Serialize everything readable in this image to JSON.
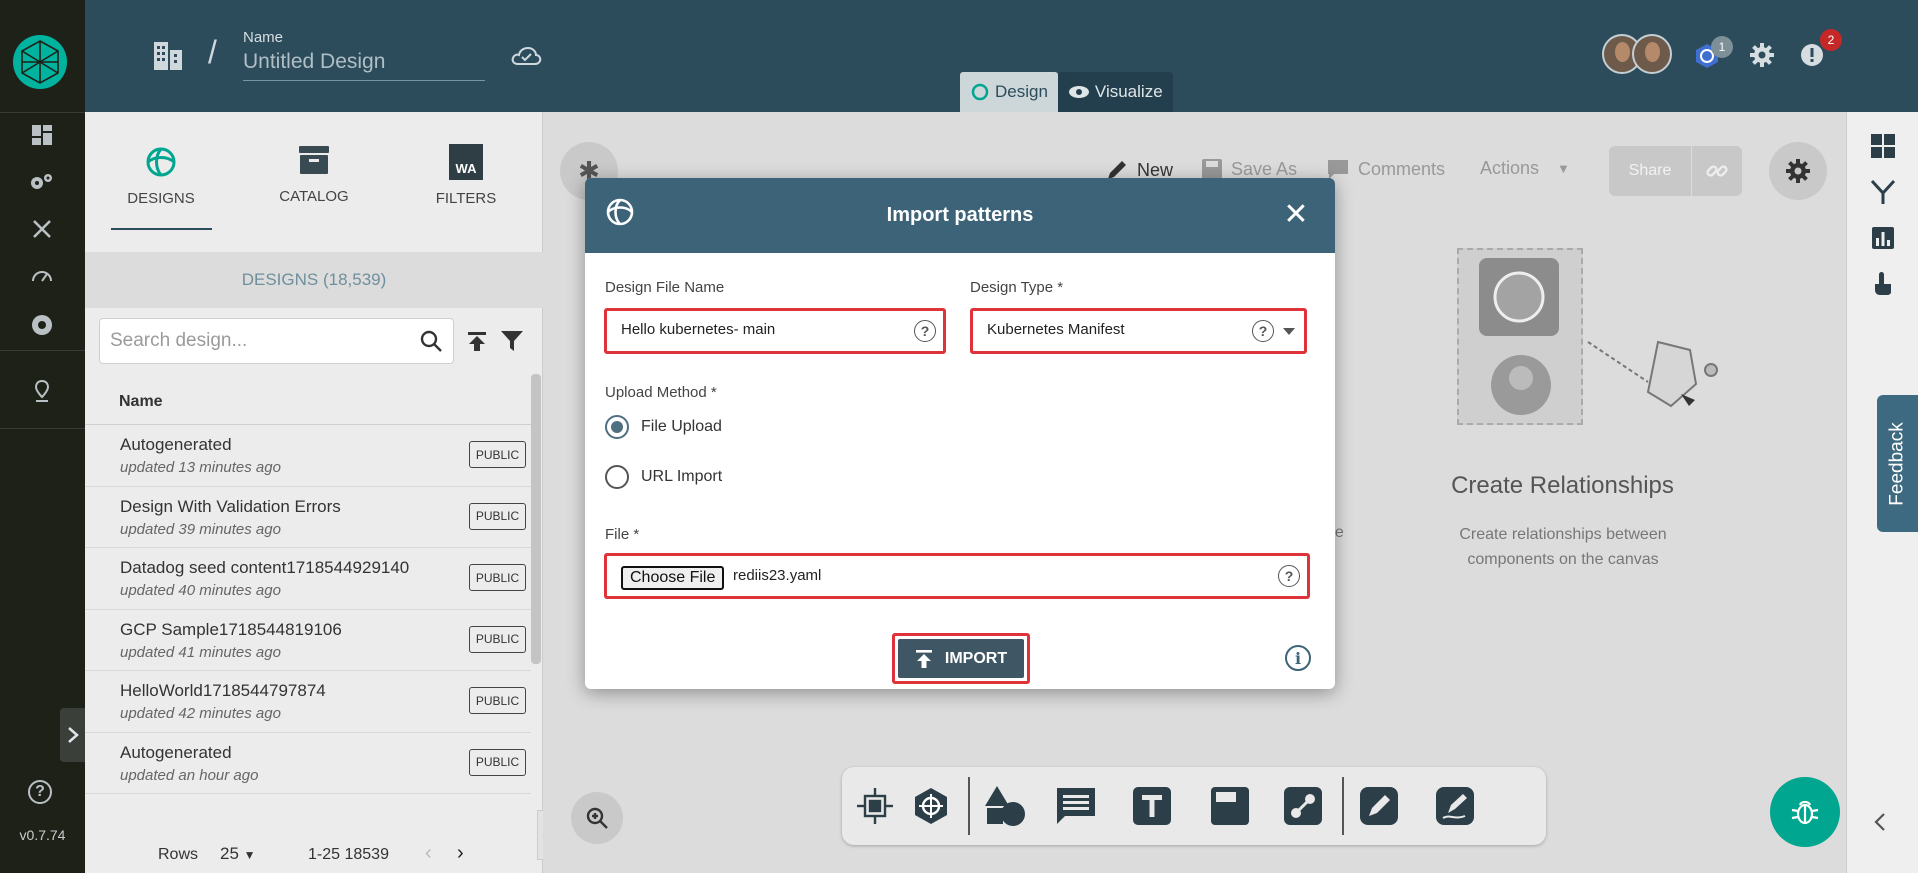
{
  "app": {
    "version": "v0.7.74"
  },
  "header": {
    "name_label": "Name",
    "design_name": "Untitled Design",
    "tab_design": "Design",
    "tab_visualize": "Visualize",
    "k8s_badge": "1",
    "alerts_badge": "2"
  },
  "panel": {
    "tab_designs": "DESIGNS",
    "tab_catalog": "CATALOG",
    "tab_filters": "FILTERS",
    "filters_icon_text": "WA",
    "designs_count": "DESIGNS (18,539)",
    "search_placeholder": "Search design...",
    "column_name": "Name",
    "rows": [
      {
        "title": "Autogenerated",
        "subtitle": "updated 13 minutes ago",
        "badge": "PUBLIC"
      },
      {
        "title": "Design With Validation Errors",
        "subtitle": "updated 39 minutes ago",
        "badge": "PUBLIC"
      },
      {
        "title": "Datadog seed content1718544929140",
        "subtitle": "updated 40 minutes ago",
        "badge": "PUBLIC"
      },
      {
        "title": "GCP Sample1718544819106",
        "subtitle": "updated 41 minutes ago",
        "badge": "PUBLIC"
      },
      {
        "title": "HelloWorld1718544797874",
        "subtitle": "updated 42 minutes ago",
        "badge": "PUBLIC"
      },
      {
        "title": "Autogenerated",
        "subtitle": "updated an hour ago",
        "badge": "PUBLIC"
      }
    ],
    "pager": {
      "rows_label": "Rows",
      "rows_value": "25",
      "range": "1-25 18539"
    }
  },
  "canvas": {
    "toolbar": {
      "new": "New",
      "save_as": "Save As",
      "comments": "Comments",
      "actions": "Actions",
      "share": "Share"
    },
    "hint_title": "Create Relationships",
    "hint_desc": "Create relationships between components on the canvas",
    "hint_fragment": "he"
  },
  "feedback_label": "Feedback",
  "modal": {
    "title": "Import patterns",
    "file_name_label": "Design File Name",
    "file_name_value": "Hello kubernetes- main",
    "design_type_label": "Design Type *",
    "design_type_value": "Kubernetes Manifest",
    "upload_method_label": "Upload Method *",
    "option_file_upload": "File Upload",
    "option_url_import": "URL Import",
    "file_label": "File *",
    "choose_file": "Choose File",
    "file_value": "rediis23.yaml",
    "import_button": "IMPORT"
  },
  "colors": {
    "header_bg": "#2c4c5c",
    "modal_header_bg": "#3c6378",
    "highlight_border": "#e0323a",
    "accent": "#00b39f"
  }
}
